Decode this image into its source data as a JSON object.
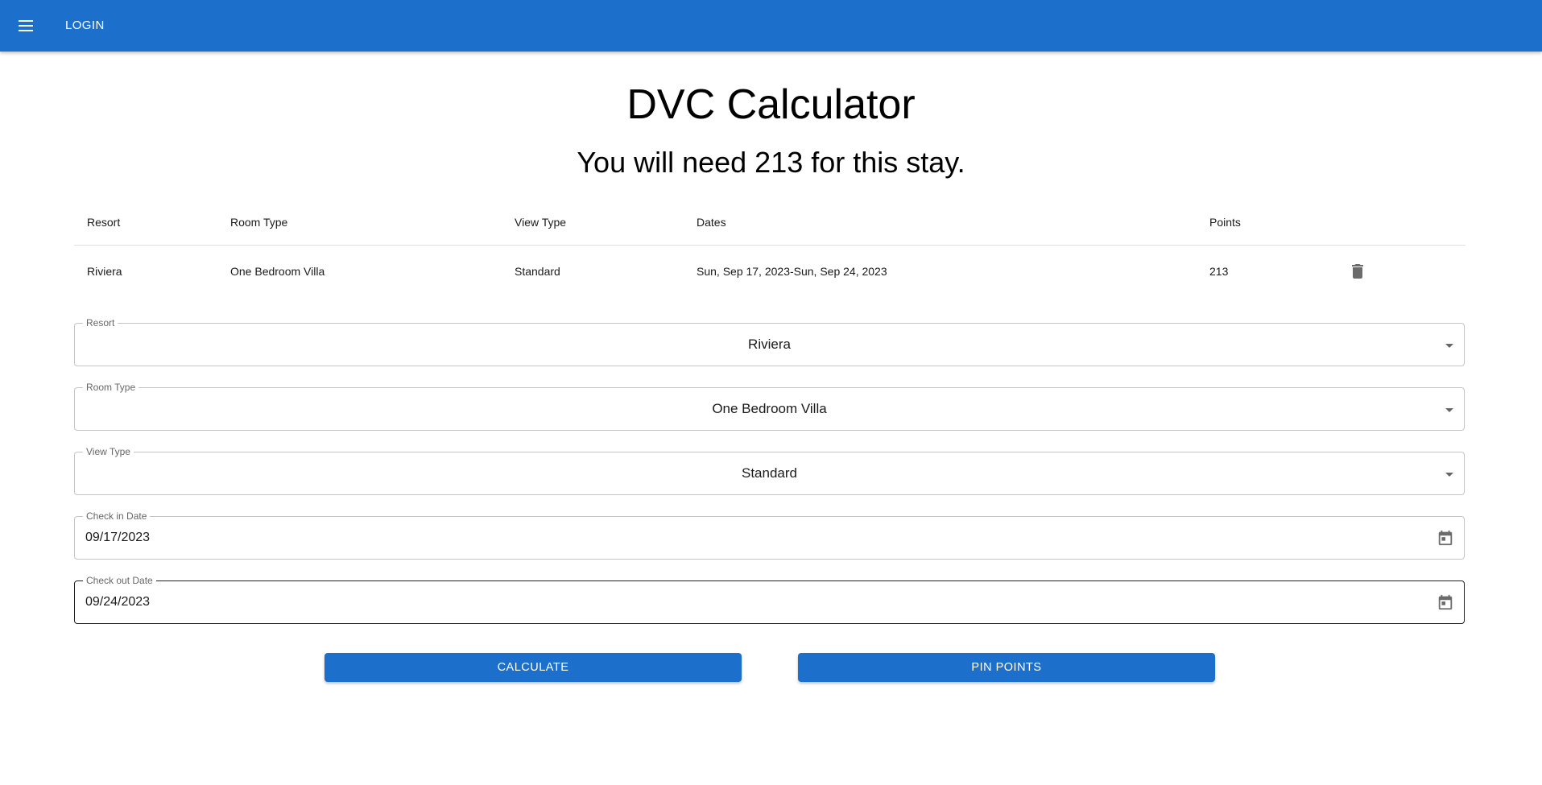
{
  "header": {
    "menu_icon": "menu-icon",
    "login_label": "LOGIN"
  },
  "main": {
    "title": "DVC Calculator",
    "summary": "You will need 213 for this stay."
  },
  "table": {
    "headers": {
      "resort": "Resort",
      "room_type": "Room Type",
      "view_type": "View Type",
      "dates": "Dates",
      "points": "Points"
    },
    "rows": [
      {
        "resort": "Riviera",
        "room_type": "One Bedroom Villa",
        "view_type": "Standard",
        "dates": "Sun, Sep 17, 2023-Sun, Sep 24, 2023",
        "points": "213",
        "action_icon": "trash-icon"
      }
    ]
  },
  "form": {
    "resort": {
      "label": "Resort",
      "value": "Riviera"
    },
    "room_type": {
      "label": "Room Type",
      "value": "One Bedroom Villa"
    },
    "view_type": {
      "label": "View Type",
      "value": "Standard"
    },
    "check_in": {
      "label": "Check in Date",
      "value": "09/17/2023"
    },
    "check_out": {
      "label": "Check out Date",
      "value": "09/24/2023"
    }
  },
  "actions": {
    "calculate_label": "CALCULATE",
    "pin_points_label": "PIN POINTS"
  },
  "colors": {
    "primary": "#1c6fca",
    "border": "#c4c4c4",
    "label": "#666666"
  }
}
